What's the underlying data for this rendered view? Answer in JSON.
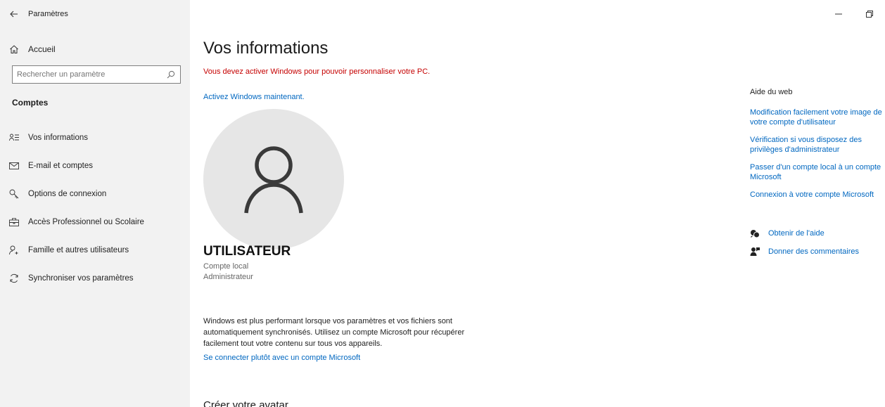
{
  "window": {
    "title": "Paramètres"
  },
  "sidebar": {
    "home_label": "Accueil",
    "search_placeholder": "Rechercher un paramètre",
    "section_title": "Comptes",
    "items": [
      {
        "label": "Vos informations",
        "icon": "person-list-icon"
      },
      {
        "label": "E-mail et comptes",
        "icon": "mail-icon"
      },
      {
        "label": "Options de connexion",
        "icon": "key-icon"
      },
      {
        "label": "Accès Professionnel ou Scolaire",
        "icon": "briefcase-icon"
      },
      {
        "label": "Famille et autres utilisateurs",
        "icon": "person-add-icon"
      },
      {
        "label": "Synchroniser vos paramètres",
        "icon": "sync-icon"
      }
    ]
  },
  "main": {
    "title": "Vos informations",
    "activation_warning": "Vous devez activer Windows pour pouvoir personnaliser votre PC.",
    "activation_link": "Activez Windows maintenant.",
    "user": {
      "name": "UTILISATEUR",
      "account_type": "Compte local",
      "role": "Administrateur"
    },
    "sync_text": "Windows est plus performant lorsque vos paramètres et vos fichiers sont automatiquement synchronisés. Utilisez un compte Microsoft pour récupérer facilement tout votre contenu sur tous vos appareils.",
    "ms_link": "Se connecter plutôt avec un compte Microsoft",
    "avatar_heading": "Créer votre avatar"
  },
  "right_panel": {
    "help_title": "Aide du web",
    "links": [
      "Modification facilement votre image de votre compte d'utilisateur",
      "Vérification si vous disposez des privilèges d'administrateur",
      "Passer d'un compte local à un compte Microsoft",
      "Connexion à votre compte Microsoft"
    ],
    "get_help": "Obtenir de l'aide",
    "feedback": "Donner des commentaires"
  },
  "colors": {
    "accent": "#0067c0",
    "warning": "#c50000",
    "sidebar_bg": "#f2f2f2"
  }
}
